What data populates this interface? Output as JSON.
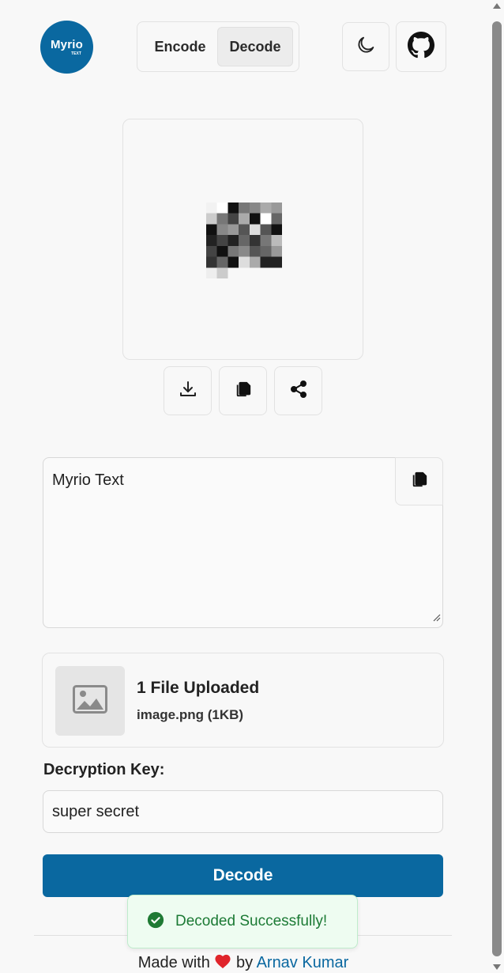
{
  "app": {
    "logo_name": "Myrio",
    "logo_sub": "TEXT"
  },
  "header": {
    "tabs": [
      {
        "label": "Encode"
      },
      {
        "label": "Decode"
      }
    ],
    "active_tab": "Decode",
    "theme_icon": "moon-icon",
    "github_icon": "github-icon"
  },
  "preview": {
    "actions": [
      {
        "icon": "download-icon"
      },
      {
        "icon": "copy-icon"
      },
      {
        "icon": "share-icon"
      }
    ]
  },
  "decoded": {
    "text": "Myrio Text",
    "copy_icon": "copy-icon"
  },
  "upload": {
    "title": "1 File Uploaded",
    "file": "image.png (1KB)",
    "icon": "image-icon"
  },
  "key": {
    "label": "Decryption Key:",
    "value": "super secret"
  },
  "decode_button": {
    "label": "Decode"
  },
  "toast": {
    "message": "Decoded Successfully!",
    "icon": "check-circle-icon"
  },
  "footer": {
    "prefix": "Made with",
    "by": "by",
    "author": "Arnav Kumar"
  },
  "colors": {
    "primary": "#0a68a0",
    "success": "#1c7a35",
    "heart": "#e0242b"
  }
}
